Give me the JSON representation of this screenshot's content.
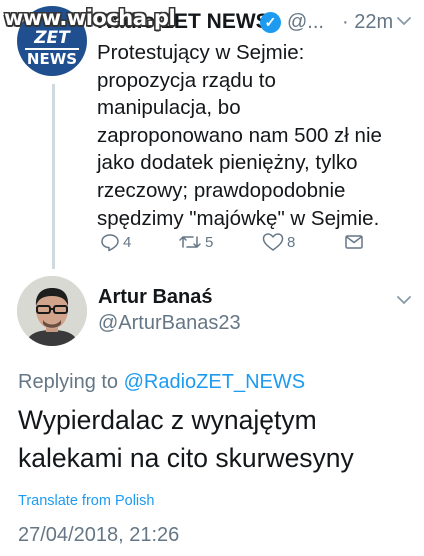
{
  "watermark": "www.wiocha.pl",
  "parent_tweet": {
    "avatar": {
      "line1": "ZET",
      "line2": "NEWS"
    },
    "display_name": "Radio ZET NEWS",
    "handle": "@...",
    "time": "· 22m",
    "text": "Protestujący w Sejmie:\npropozycja rządu to\nmanipulacja, bo\nzaproponowano nam 500 zł nie\njako dodatek pieniężny, tylko\nrzeczowy; prawdopodobnie\nspędzimy \"majówkę\" w Sejmie.",
    "actions": {
      "reply_count": "4",
      "retweet_count": "5",
      "like_count": "8"
    }
  },
  "reply_tweet": {
    "display_name": "Artur Banaś",
    "handle": "@ArturBanas23",
    "replying_prefix": "Replying to",
    "replying_mention": "@RadioZET_NEWS",
    "text": "Wypierdalac z wynajętym\nkalekami na cito skurwesyny",
    "translate_label": "Translate from Polish",
    "timestamp": "27/04/2018, 21:26"
  },
  "colors": {
    "brand_blue": "#1d9bf0",
    "secondary_text": "#657786",
    "primary_text": "#14171a",
    "zet_avatar_bg": "#1f4f8f"
  },
  "icons": [
    "verified-badge-icon",
    "chevron-down-icon",
    "reply-icon",
    "retweet-icon",
    "like-icon",
    "share-icon"
  ]
}
